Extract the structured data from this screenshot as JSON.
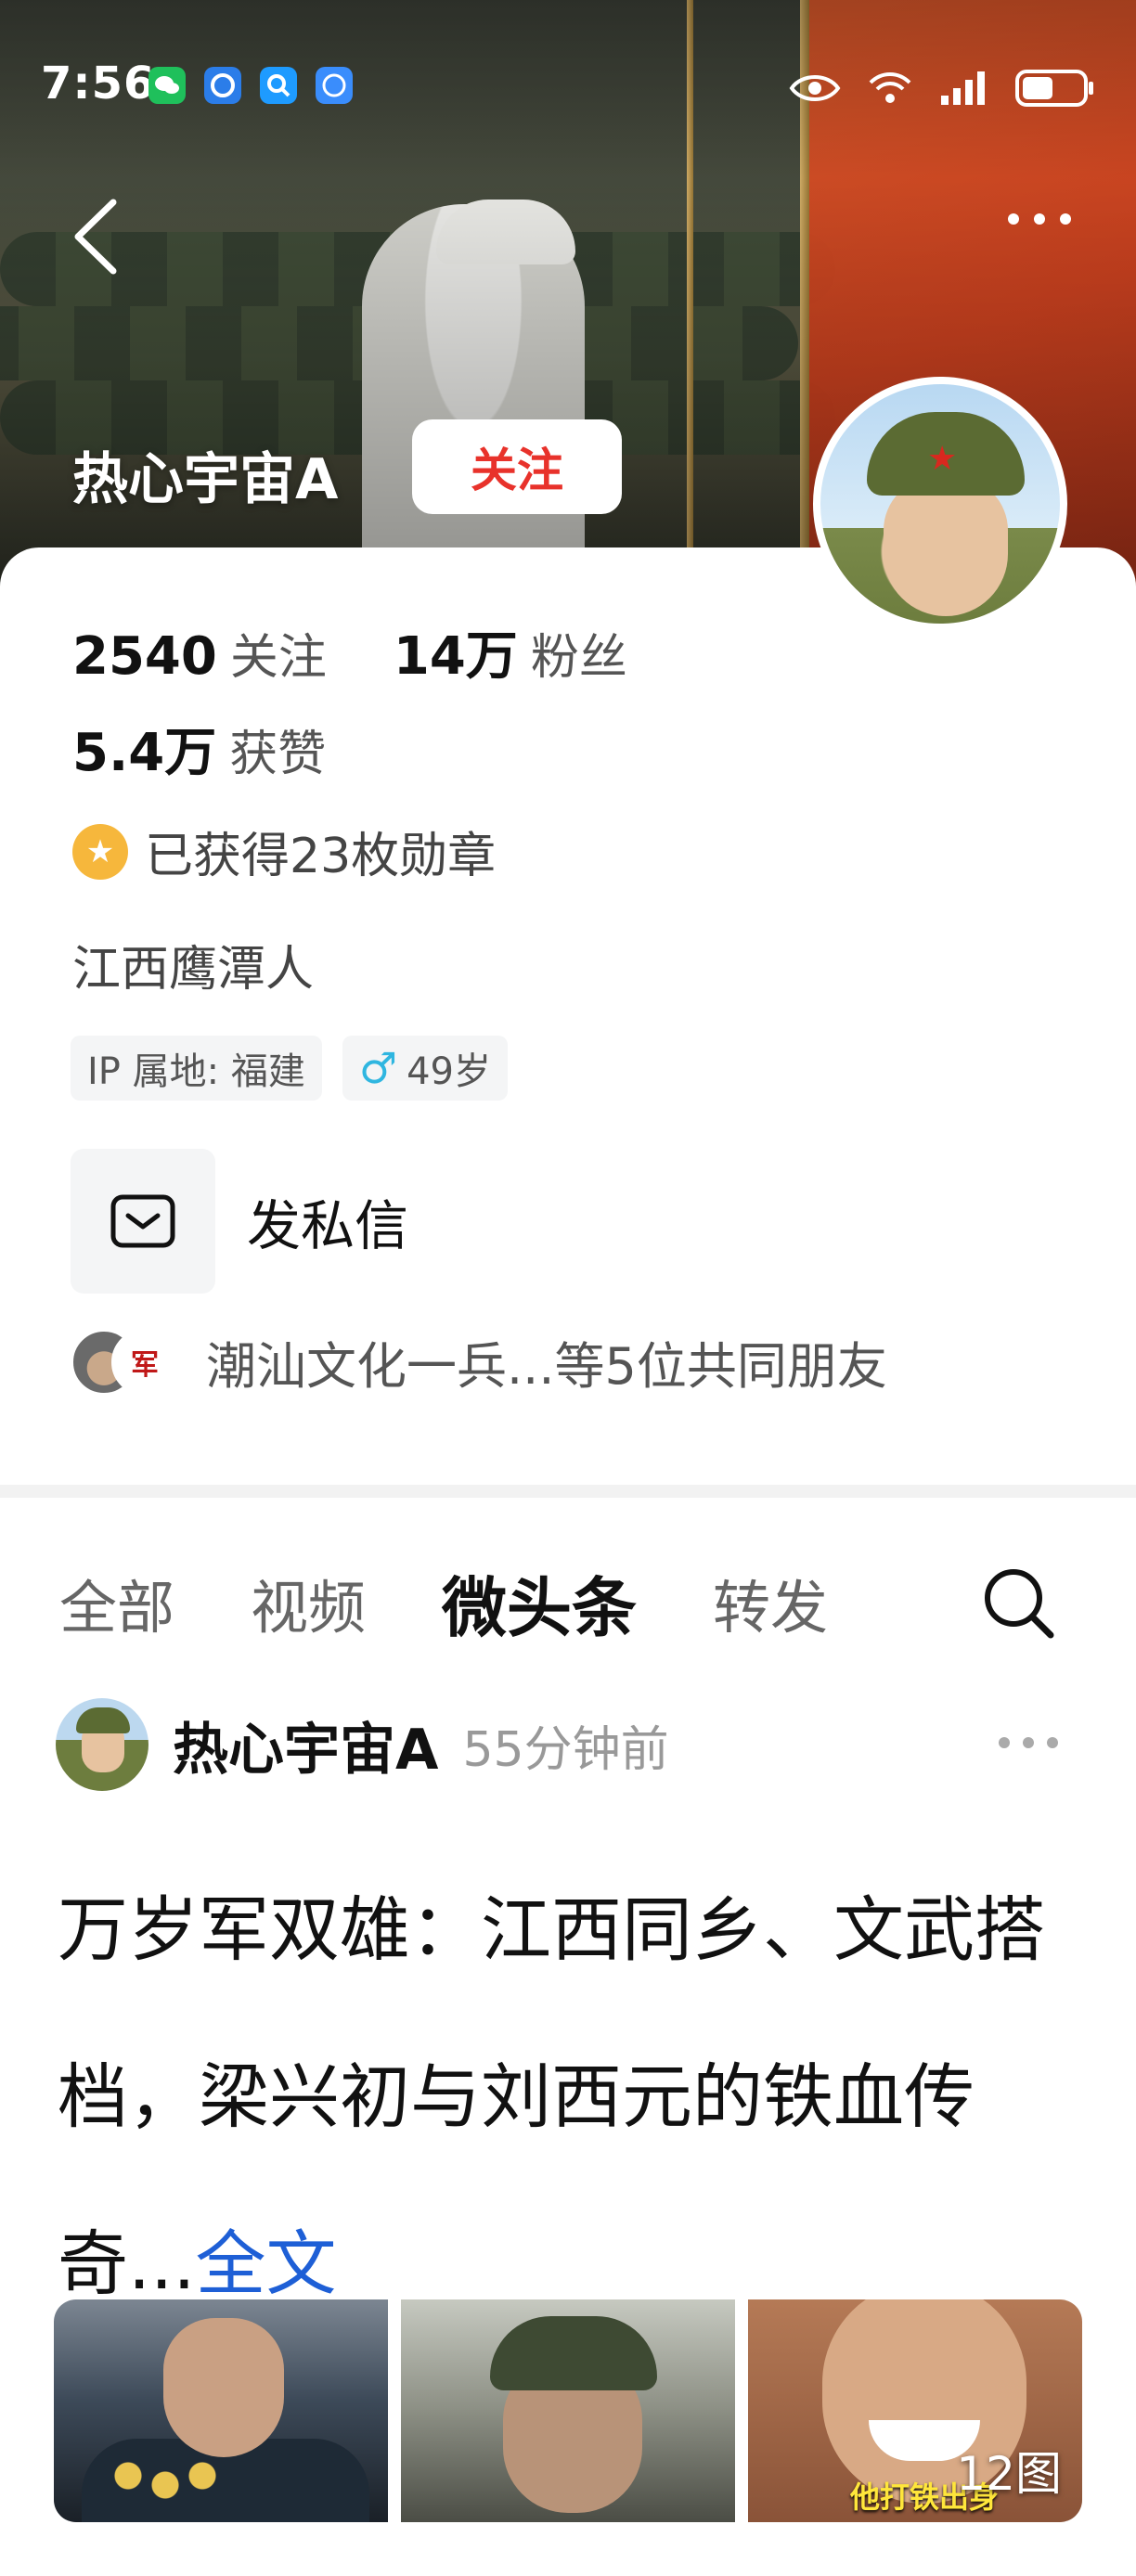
{
  "status_bar": {
    "time": "7:56",
    "app_icons": [
      "wechat-icon",
      "browser-icon",
      "search-app-icon",
      "compass-icon"
    ],
    "right_icons": [
      "eye-icon",
      "wifi-icon",
      "signal-icon",
      "battery-icon"
    ]
  },
  "header": {
    "back_icon": "chevron-left-icon",
    "more_icon": "more-dots-icon",
    "name": "热心宇宙A",
    "follow_label": "关注",
    "colors": {
      "follow_text": "#e8322b"
    }
  },
  "stats": {
    "following_count": "2540",
    "following_label": "关注",
    "fans_count": "14万",
    "fans_label": "粉丝",
    "likes_count": "5.4万",
    "likes_label": "获赞"
  },
  "profile": {
    "medal_text": "已获得23枚勋章",
    "hometown": "江西鹰潭人",
    "ip_tag": "IP 属地: 福建",
    "age_tag": "49岁",
    "dm_label": "发私信",
    "mutual_text": "潮汕文化一兵...等5位共同朋友",
    "mutual_badge": "军"
  },
  "tabs": [
    {
      "label": "全部",
      "active": false
    },
    {
      "label": "视频",
      "active": false
    },
    {
      "label": "微头条",
      "active": true
    },
    {
      "label": "转发",
      "active": false
    }
  ],
  "post": {
    "author": "热心宇宙A",
    "time": "55分钟前",
    "text": "万岁军双雄：江西同乡、文武搭档，梁兴初与刘西元的铁血传奇...",
    "more_link": "全文",
    "image_count": "12图",
    "image3_caption": "他打铁出身"
  }
}
